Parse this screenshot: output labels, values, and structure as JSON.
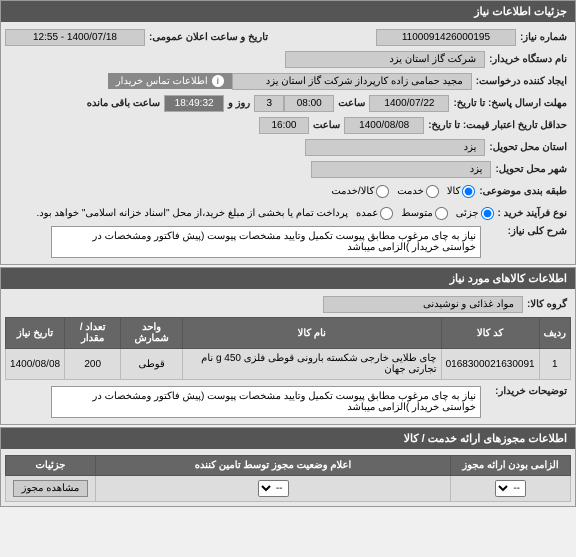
{
  "header": {
    "title": "جزئیات اطلاعات نیاز"
  },
  "main": {
    "niaz_number_label": "شماره نیاز:",
    "niaz_number": "1100091426000195",
    "announce_label": "تاریخ و ساعت اعلان عمومی:",
    "announce_value": "1400/07/18 - 12:55",
    "buyer_org_label": "نام دستگاه خریدار:",
    "buyer_org": "شرکت گاز استان یزد",
    "requester_label": "ایجاد کننده درخواست:",
    "requester": "مجید حمامی زاده کارپرداز شرکت گاز استان یزد",
    "contact_link": "اطلاعات تماس خریدار",
    "deadline_label": "مهلت ارسال پاسخ: تا تاریخ:",
    "deadline_date": "1400/07/22",
    "deadline_time_label": "ساعت",
    "deadline_time": "08:00",
    "days_label": "روز و",
    "days_value": "3",
    "remaining_time": "18:49:32",
    "remaining_label": "ساعت باقی مانده",
    "validity_label": "حداقل تاریخ اعتبار قیمت: تا تاریخ:",
    "validity_date": "1400/08/08",
    "validity_time_label": "ساعت",
    "validity_time": "16:00",
    "delivery_state_label": "استان محل تحویل:",
    "delivery_state": "یزد",
    "delivery_city_label": "شهر محل تحویل:",
    "delivery_city": "یزد",
    "group_label": "طبقه بندی موضوعی:",
    "group_options": {
      "kala": "کالا",
      "khadamat": "خدمت",
      "both": "کالا/خدمت"
    },
    "purchase_type_label": "نوع فرآیند خرید :",
    "purchase_options": {
      "khord": "جزئی",
      "motevasset": "متوسط",
      "omde": "عمده"
    },
    "purchase_note": "پرداخت تمام یا بخشی از مبلغ خرید،از محل \"اسناد خزانه اسلامی\" خواهد بود.",
    "desc_label": "شرح کلی نیاز:",
    "desc_text": "نیاز به چای مرغوب مطابق پیوست تکمیل وتایید مشخصات پیوست (پیش فاکتور ومشخصات در خواستی خریدار )الزامی میباشد"
  },
  "items_header": "اطلاعات کالاهای مورد نیاز",
  "items": {
    "group_label": "گروه کالا:",
    "group_value": "مواد غذائی و نوشیدنی",
    "columns": [
      "ردیف",
      "کد کالا",
      "نام کالا",
      "واحد شمارش",
      "تعداد / مقدار",
      "تاریخ نیاز"
    ],
    "rows": [
      {
        "n": "1",
        "code": "0168300021630091",
        "name": "چای طلایی خارجی شکسته بارونی قوطی فلزی 450 g نام تجارتی جهان",
        "unit": "قوطی",
        "qty": "200",
        "date": "1400/08/08"
      }
    ],
    "buyer_notes_label": "توضیحات خریدار:",
    "buyer_notes": "نیاز به چای مرغوب مطابق پیوست تکمیل وتایید مشخصات پیوست (پیش فاکتور ومشخصات در خواستی خریدار )الزامی میباشد"
  },
  "permits_header": "اطلاعات مجوزهای ارائه خدمت / کالا",
  "permits": {
    "mandatory_col": "الزامی بودن ارائه مجوز",
    "status_col": "اعلام وضعیت مجوز توسط تامین کننده",
    "details_col": "جزئیات",
    "select_placeholder": "--",
    "view_btn": "مشاهده مجوز"
  }
}
